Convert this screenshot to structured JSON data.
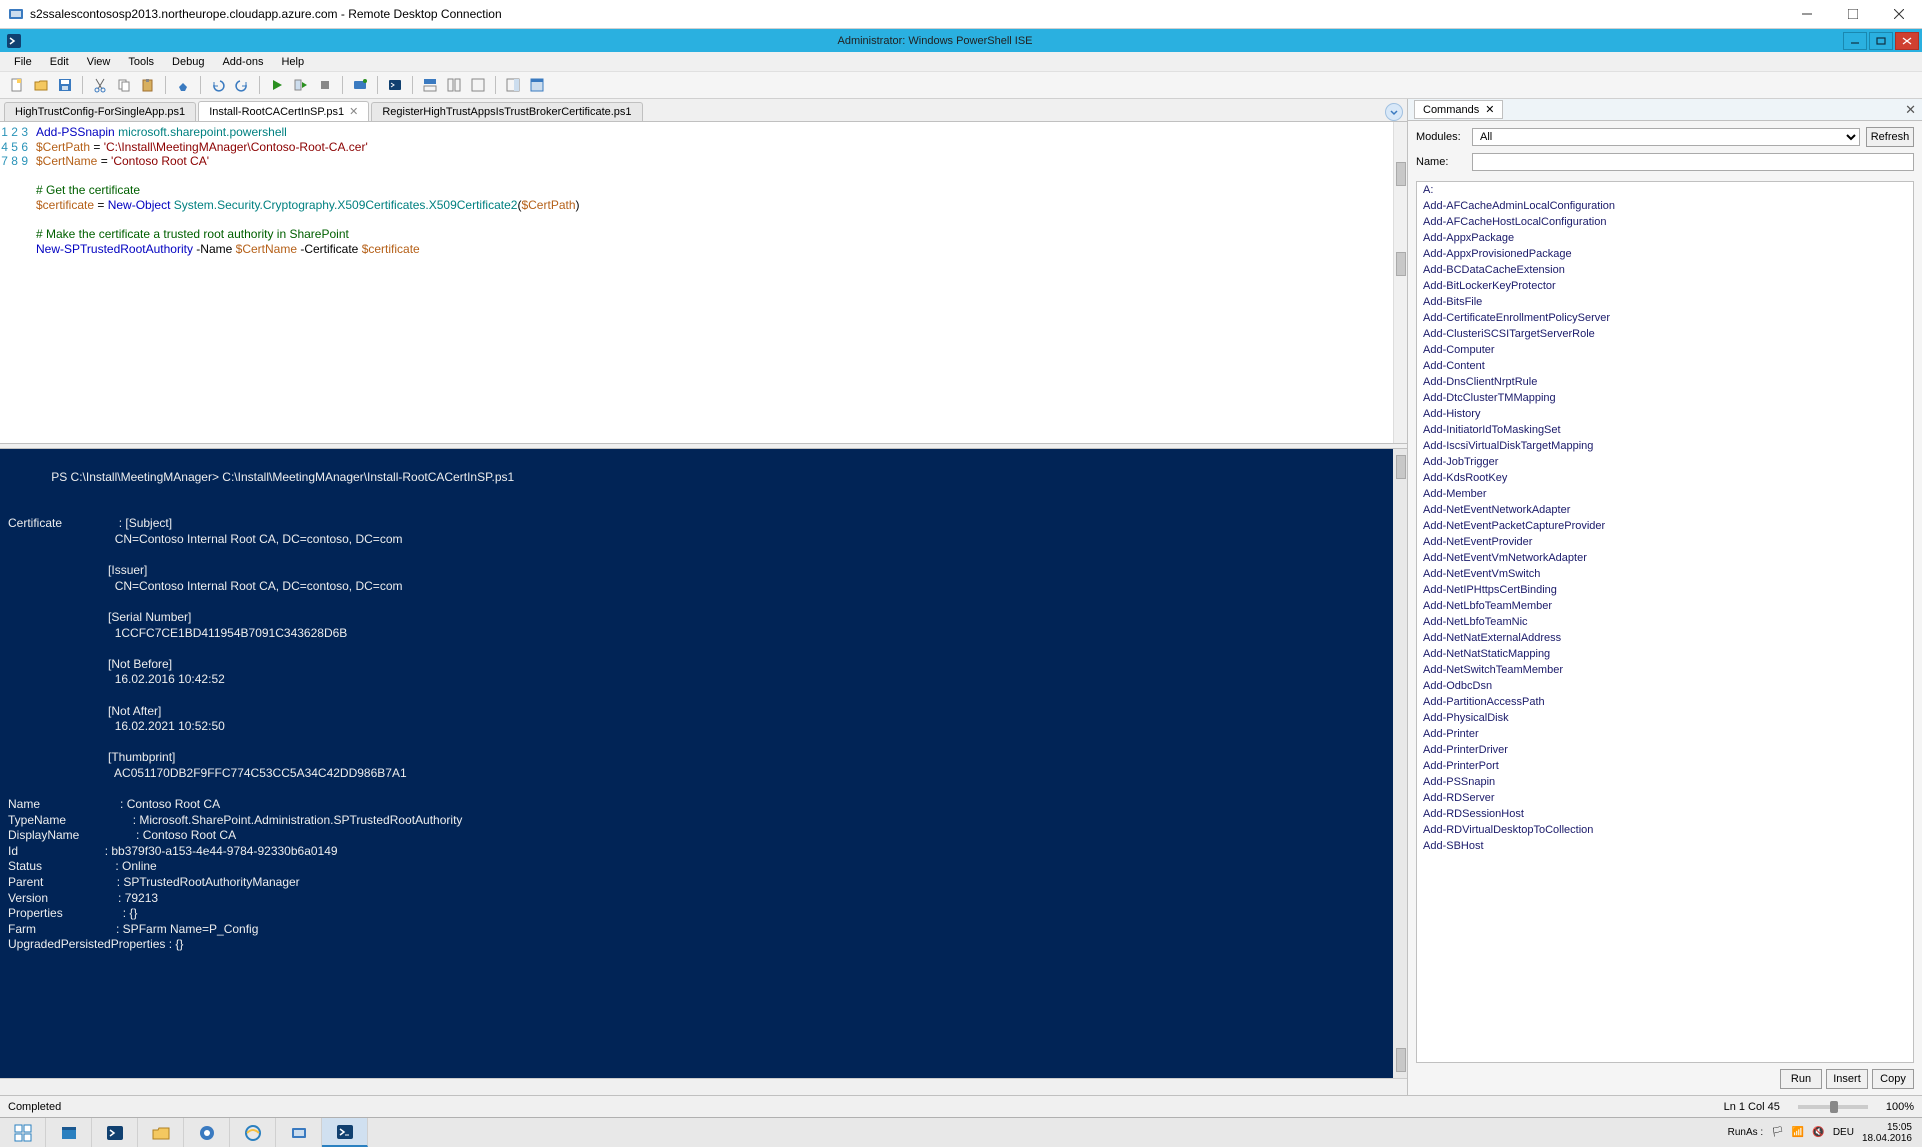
{
  "rdp": {
    "title": "s2ssalescontososp2013.northeurope.cloudapp.azure.com - Remote Desktop Connection"
  },
  "ise": {
    "title": "Administrator: Windows PowerShell ISE"
  },
  "menubar": [
    "File",
    "Edit",
    "View",
    "Tools",
    "Debug",
    "Add-ons",
    "Help"
  ],
  "tabs": [
    {
      "label": "HighTrustConfig-ForSingleApp.ps1",
      "active": false,
      "closeable": false
    },
    {
      "label": "Install-RootCACertInSP.ps1",
      "active": true,
      "closeable": true
    },
    {
      "label": "RegisterHighTrustAppsIsTrustBrokerCertificate.ps1",
      "active": false,
      "closeable": false
    }
  ],
  "editor": {
    "line_numbers": [
      1,
      2,
      3,
      4,
      5,
      6,
      7,
      8,
      9
    ],
    "code_tokens": [
      [
        {
          "c": "kw",
          "t": "Add-PSSnapin"
        },
        {
          "c": "",
          "t": " "
        },
        {
          "c": "type",
          "t": "microsoft.sharepoint.powershell"
        }
      ],
      [
        {
          "c": "var",
          "t": "$CertPath"
        },
        {
          "c": "",
          "t": " = "
        },
        {
          "c": "str",
          "t": "'C:\\Install\\MeetingMAnager\\Contoso-Root-CA.cer'"
        }
      ],
      [
        {
          "c": "var",
          "t": "$CertName"
        },
        {
          "c": "",
          "t": " = "
        },
        {
          "c": "str",
          "t": "'Contoso Root CA'"
        }
      ],
      [],
      [
        {
          "c": "cmt",
          "t": "# Get the certificate"
        }
      ],
      [
        {
          "c": "var",
          "t": "$certificate"
        },
        {
          "c": "",
          "t": " = "
        },
        {
          "c": "kw",
          "t": "New-Object"
        },
        {
          "c": "",
          "t": " "
        },
        {
          "c": "type",
          "t": "System.Security.Cryptography.X509Certificates.X509Certificate2"
        },
        {
          "c": "",
          "t": "("
        },
        {
          "c": "var",
          "t": "$CertPath"
        },
        {
          "c": "",
          "t": ")"
        }
      ],
      [],
      [
        {
          "c": "cmt",
          "t": "# Make the certificate a trusted root authority in SharePoint"
        }
      ],
      [
        {
          "c": "kw",
          "t": "New-SPTrustedRootAuthority"
        },
        {
          "c": "",
          "t": " -Name "
        },
        {
          "c": "var",
          "t": "$CertName"
        },
        {
          "c": "",
          "t": " -Certificate "
        },
        {
          "c": "var",
          "t": "$certificate"
        }
      ]
    ]
  },
  "console_text": "PS C:\\Install\\MeetingMAnager> C:\\Install\\MeetingMAnager\\Install-RootCACertInSP.ps1\n\n\nCertificate                 : [Subject]\n                                CN=Contoso Internal Root CA, DC=contoso, DC=com\n\n                              [Issuer]\n                                CN=Contoso Internal Root CA, DC=contoso, DC=com\n\n                              [Serial Number]\n                                1CCFC7CE1BD411954B7091C343628D6B\n\n                              [Not Before]\n                                16.02.2016 10:42:52\n\n                              [Not After]\n                                16.02.2021 10:52:50\n\n                              [Thumbprint]\n                                AC051170DB2F9FFC774C53CC5A34C42DD986B7A1\n\nName                        : Contoso Root CA\nTypeName                    : Microsoft.SharePoint.Administration.SPTrustedRootAuthority\nDisplayName                 : Contoso Root CA\nId                          : bb379f30-a153-4e44-9784-92330b6a0149\nStatus                      : Online\nParent                      : SPTrustedRootAuthorityManager\nVersion                     : 79213\nProperties                  : {}\nFarm                        : SPFarm Name=P_Config\nUpgradedPersistedProperties : {}",
  "commands_panel": {
    "tab_label": "Commands",
    "modules_label": "Modules:",
    "modules_value": "All",
    "name_label": "Name:",
    "name_value": "",
    "refresh": "Refresh",
    "actions": {
      "run": "Run",
      "insert": "Insert",
      "copy": "Copy"
    },
    "list": [
      "A:",
      "Add-AFCacheAdminLocalConfiguration",
      "Add-AFCacheHostLocalConfiguration",
      "Add-AppxPackage",
      "Add-AppxProvisionedPackage",
      "Add-BCDataCacheExtension",
      "Add-BitLockerKeyProtector",
      "Add-BitsFile",
      "Add-CertificateEnrollmentPolicyServer",
      "Add-ClusteriSCSITargetServerRole",
      "Add-Computer",
      "Add-Content",
      "Add-DnsClientNrptRule",
      "Add-DtcClusterTMMapping",
      "Add-History",
      "Add-InitiatorIdToMaskingSet",
      "Add-IscsiVirtualDiskTargetMapping",
      "Add-JobTrigger",
      "Add-KdsRootKey",
      "Add-Member",
      "Add-NetEventNetworkAdapter",
      "Add-NetEventPacketCaptureProvider",
      "Add-NetEventProvider",
      "Add-NetEventVmNetworkAdapter",
      "Add-NetEventVmSwitch",
      "Add-NetIPHttpsCertBinding",
      "Add-NetLbfoTeamMember",
      "Add-NetLbfoTeamNic",
      "Add-NetNatExternalAddress",
      "Add-NetNatStaticMapping",
      "Add-NetSwitchTeamMember",
      "Add-OdbcDsn",
      "Add-PartitionAccessPath",
      "Add-PhysicalDisk",
      "Add-Printer",
      "Add-PrinterDriver",
      "Add-PrinterPort",
      "Add-PSSnapin",
      "Add-RDServer",
      "Add-RDSessionHost",
      "Add-RDVirtualDesktopToCollection",
      "Add-SBHost"
    ]
  },
  "status": {
    "left": "Completed",
    "pos": "Ln 1  Col 45",
    "zoom": "100%"
  },
  "taskbar": {
    "lang": "DEU",
    "runas": "RunAs :",
    "time": "15:05",
    "date": "18.04.2016"
  }
}
